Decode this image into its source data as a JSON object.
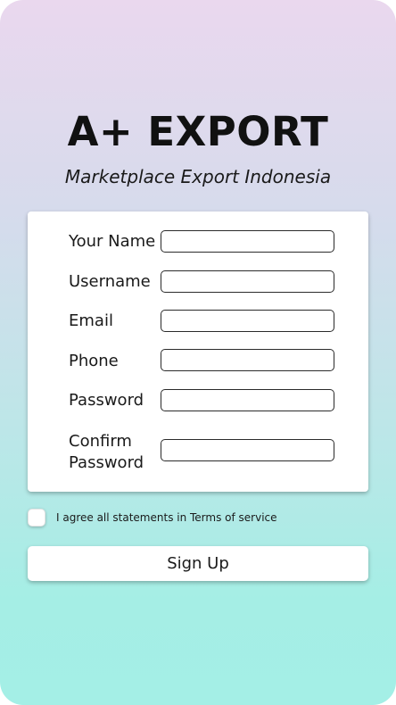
{
  "header": {
    "brand": "A+ EXPORT",
    "tagline": "Marketplace Export Indonesia"
  },
  "form": {
    "fields": [
      {
        "label": "Your Name",
        "value": ""
      },
      {
        "label": "Username",
        "value": ""
      },
      {
        "label": "Email",
        "value": ""
      },
      {
        "label": "Phone",
        "value": ""
      },
      {
        "label": "Password",
        "value": ""
      },
      {
        "label": "Confirm\nPassword",
        "value": ""
      }
    ]
  },
  "agreement": {
    "checked": false,
    "text": "I agree all statements in Terms of service"
  },
  "actions": {
    "signup_label": "Sign Up"
  },
  "colors": {
    "gradient_top": "#ead8ee",
    "gradient_bottom": "#a4efe6",
    "text": "#111111"
  }
}
